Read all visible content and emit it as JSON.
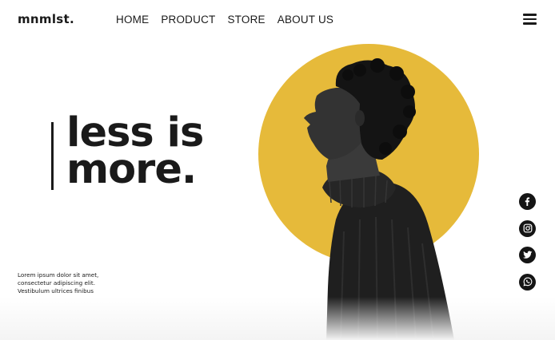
{
  "brand": {
    "logo": "mnmlst."
  },
  "nav": {
    "items": [
      {
        "label": "HOME"
      },
      {
        "label": "PRODUCT"
      },
      {
        "label": "STORE"
      },
      {
        "label": "ABOUT US"
      }
    ],
    "menu_icon": "hamburger-menu-icon"
  },
  "hero": {
    "headline_line1": "less is",
    "headline_line2": "more.",
    "blurb_line1": "Lorem ipsum dolor sit amet,",
    "blurb_line2": "consectetur adipiscing elit.",
    "blurb_line3": "Vestibulum ultrices finibus",
    "accent_color": "#e6ba3a"
  },
  "social": [
    {
      "icon": "facebook-icon"
    },
    {
      "icon": "instagram-icon"
    },
    {
      "icon": "twitter-icon"
    },
    {
      "icon": "whatsapp-icon"
    }
  ]
}
